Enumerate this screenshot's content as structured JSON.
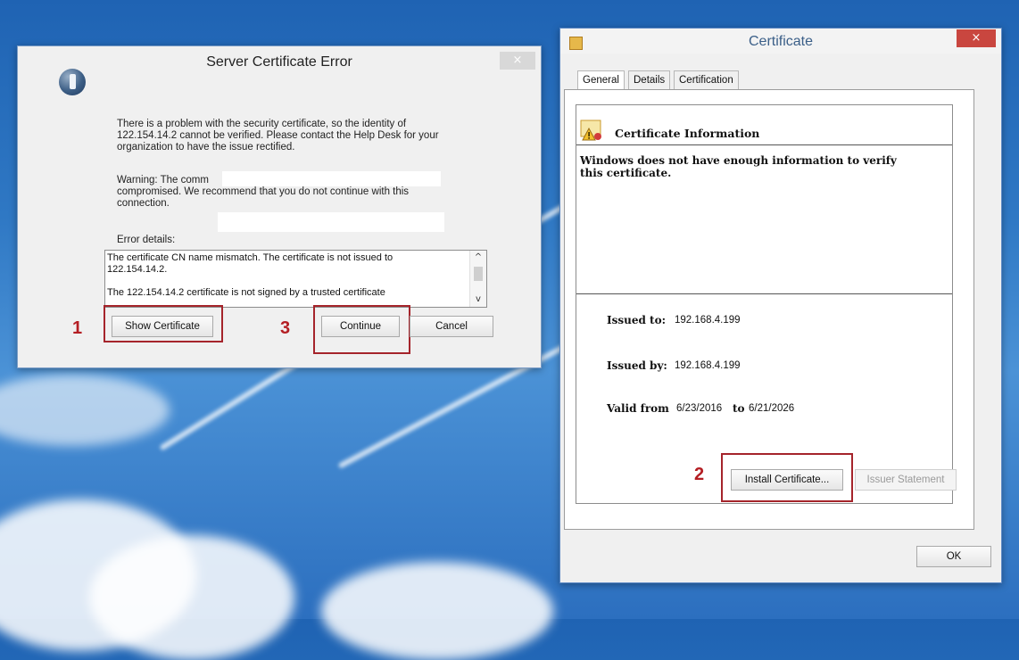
{
  "server_dialog": {
    "title": "Server Certificate Error",
    "close_glyph": "×",
    "icon": "info-shield-icon",
    "message": "There is a problem with the security certificate, so the identity of 122.154.14.2 cannot be verified. Please contact the Help Desk for your organization to have the issue rectified.",
    "warning_line1": "Warning: The comm",
    "warning_line2": "compromised. We recommend that you do not continue with this",
    "warning_line3": "connection.",
    "error_details_label": "Error details:",
    "error_text_line1": "The certificate CN name mismatch. The certificate is not issued to",
    "error_text_line2": "122.154.14.2.",
    "error_text_line3": "The 122.154.14.2 certificate is not signed by a trusted certificate",
    "scroll_up_glyph": "^",
    "scroll_down_glyph": "v",
    "buttons": {
      "show_certificate": "Show Certificate",
      "continue": "Continue",
      "cancel": "Cancel"
    }
  },
  "cert_dialog": {
    "title": "Certificate",
    "close_glyph": "×",
    "tabs": [
      "General",
      "Details",
      "Certification Path"
    ],
    "info_heading": "Certificate Information",
    "warning": "Windows does not have enough information to verify this certificate.",
    "issued_to_label": "Issued to:",
    "issued_to_value": "192.168.4.199",
    "issued_by_label": "Issued by:",
    "issued_by_value": "192.168.4.199",
    "valid_from_label": "Valid from",
    "valid_from_value": "6/23/2016",
    "valid_to_label": "to",
    "valid_to_value": "6/21/2026",
    "buttons": {
      "install_certificate": "Install Certificate...",
      "issuer_statement": "Issuer Statement",
      "ok": "OK"
    }
  },
  "annotations": {
    "step1": "1",
    "step2": "2",
    "step3": "3",
    "color": "#b41e23"
  }
}
